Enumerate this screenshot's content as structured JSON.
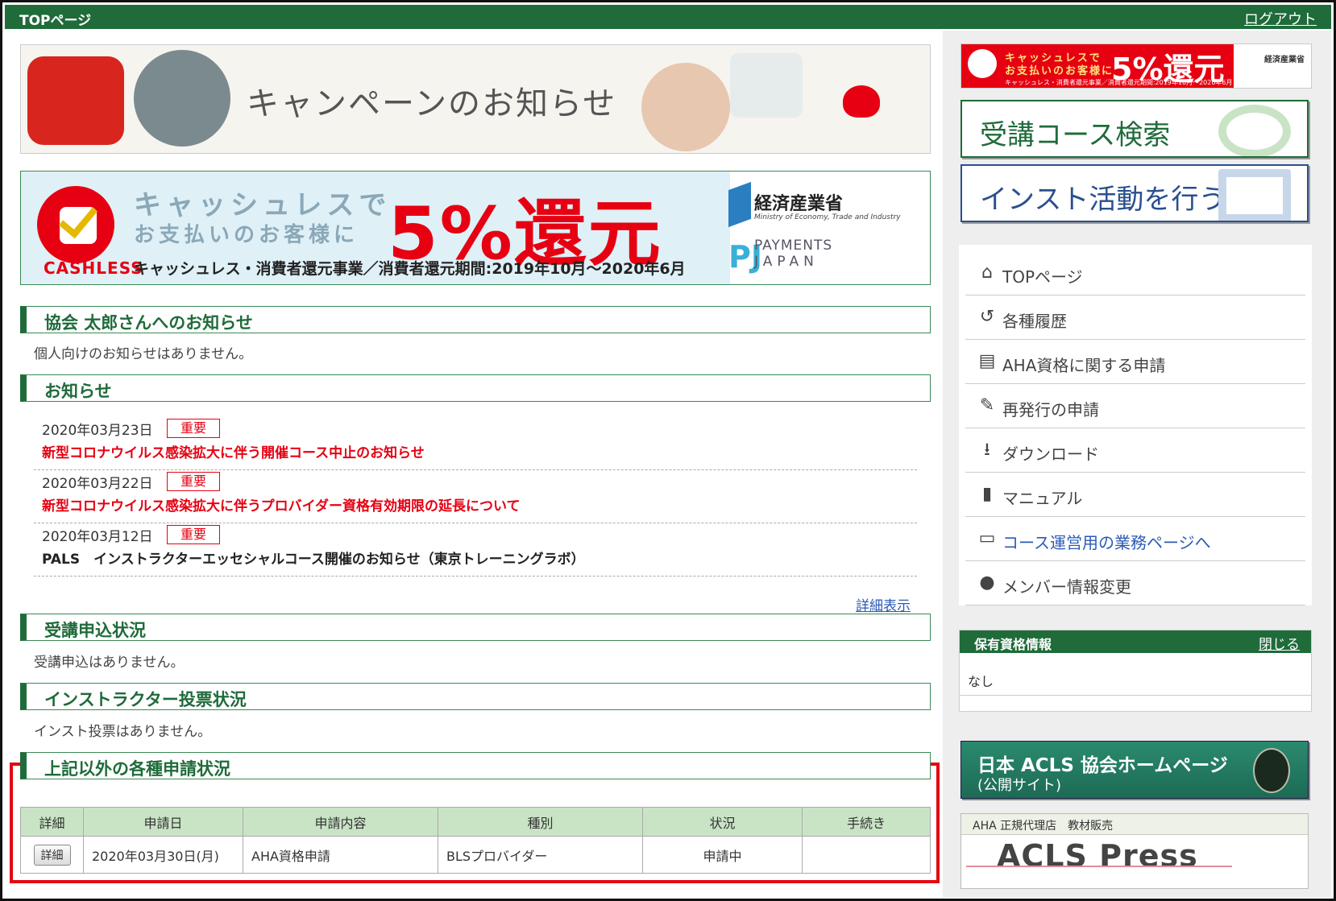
{
  "header": {
    "title": "TOPページ",
    "logout": "ログアウト"
  },
  "banners": {
    "campaign": "キャンペーンのお知らせ",
    "cashless": {
      "line1": "キャッシュレスで",
      "line2": "お支払いのお客様に",
      "big": "5%還元",
      "logo_word": "CASHLESS",
      "footer": "キャッシュレス・消費者還元事業／消費者還元期間:2019年10月〜2020年6月",
      "ministry": "経済産業省",
      "ministry_en": "Ministry of Economy, Trade and Industry",
      "payments": "PAYMENTS",
      "japan": "JAPAN"
    }
  },
  "personal": {
    "title": "協会 太郎さんへのお知らせ",
    "empty": "個人向けのお知らせはありません。"
  },
  "news": {
    "title": "お知らせ",
    "items": [
      {
        "date": "2020年03月23日",
        "badge": "重要",
        "title": "新型コロナウイルス感染拡大に伴う開催コース中止のお知らせ"
      },
      {
        "date": "2020年03月22日",
        "badge": "重要",
        "title": "新型コロナウイルス感染拡大に伴うプロバイダー資格有効期限の延長について"
      },
      {
        "date": "2020年03月12日",
        "badge": "重要",
        "title": "PALS　インストラクターエッセシャルコース開催のお知らせ（東京トレーニングラボ）"
      }
    ],
    "more": "詳細表示"
  },
  "enroll": {
    "title": "受講申込状況",
    "empty": "受講申込はありません。"
  },
  "vote": {
    "title": "インストラクター投票状況",
    "empty": "インスト投票はありません。"
  },
  "requests": {
    "title": "上記以外の各種申請状況",
    "columns": [
      "詳細",
      "申請日",
      "申請内容",
      "種別",
      "状況",
      "手続き"
    ],
    "rows": [
      {
        "detail": "詳細",
        "date": "2020年03月30日(月)",
        "content": "AHA資格申請",
        "type": "BLSプロバイダー",
        "status": "申請中",
        "action": ""
      }
    ]
  },
  "right": {
    "mini_banner": {
      "line1": "キャッシュレスで",
      "line2": "お支払いのお客様に",
      "big": "5%還元",
      "footer": "キャッシュレス・消費者還元事業／消費者還元期間:2019年10月〜2020年6月",
      "ministry": "経済産業省"
    },
    "course_search": "受講コース検索",
    "instructor": "インスト活動を行う",
    "menu": [
      {
        "icon": "⌂",
        "label": "TOPページ"
      },
      {
        "icon": "↺",
        "label": "各種履歴"
      },
      {
        "icon": "▤",
        "label": "AHA資格に関する申請"
      },
      {
        "icon": "✎",
        "label": "再発行の申請"
      },
      {
        "icon": "⭳",
        "label": "ダウンロード"
      },
      {
        "icon": "▮",
        "label": "マニュアル"
      },
      {
        "icon": "▭",
        "label": "コース運営用の業務ページへ"
      },
      {
        "icon": "●",
        "label": "メンバー情報変更"
      }
    ],
    "qualification": {
      "title": "保有資格情報",
      "close": "閉じる",
      "value": "なし"
    },
    "acls_home": {
      "line1": "日本 ACLS 協会ホームページ",
      "line2": "(公開サイト)"
    },
    "press": {
      "header": "AHA 正規代理店　教材販売",
      "logo": "ACLS Press"
    }
  }
}
